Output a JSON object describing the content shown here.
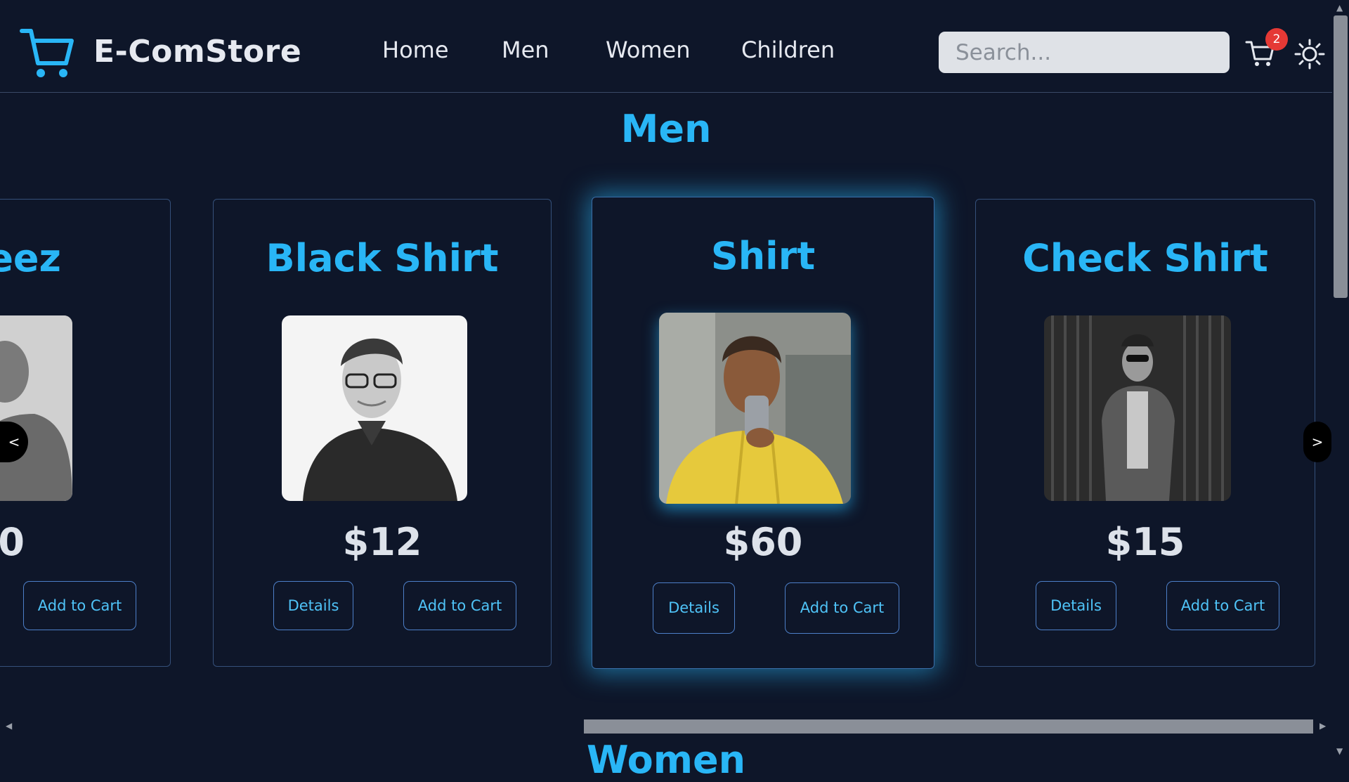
{
  "header": {
    "brand": "E-ComStore",
    "nav": [
      "Home",
      "Men",
      "Women",
      "Children"
    ],
    "search_placeholder": "Search...",
    "cart_count": "2",
    "icons": {
      "logo": "shopping-cart-icon",
      "cart": "cart-icon",
      "theme": "sun-icon"
    }
  },
  "section": {
    "title": "Men",
    "next_title": "Women"
  },
  "products": [
    {
      "title": "eez",
      "price": "0",
      "add_label": "Add to Cart"
    },
    {
      "title": "Black Shirt",
      "price": "$12",
      "details_label": "Details",
      "add_label": "Add to Cart"
    },
    {
      "title": "Shirt",
      "price": "$60",
      "details_label": "Details",
      "add_label": "Add to Cart"
    },
    {
      "title": "Check Shirt",
      "price": "$15",
      "details_label": "Details",
      "add_label": "Add to Cart"
    }
  ],
  "carousel": {
    "prev_label": "<",
    "next_label": ">"
  },
  "colors": {
    "background": "#0e1629",
    "accent": "#29b6f6",
    "badge": "#e53935"
  }
}
